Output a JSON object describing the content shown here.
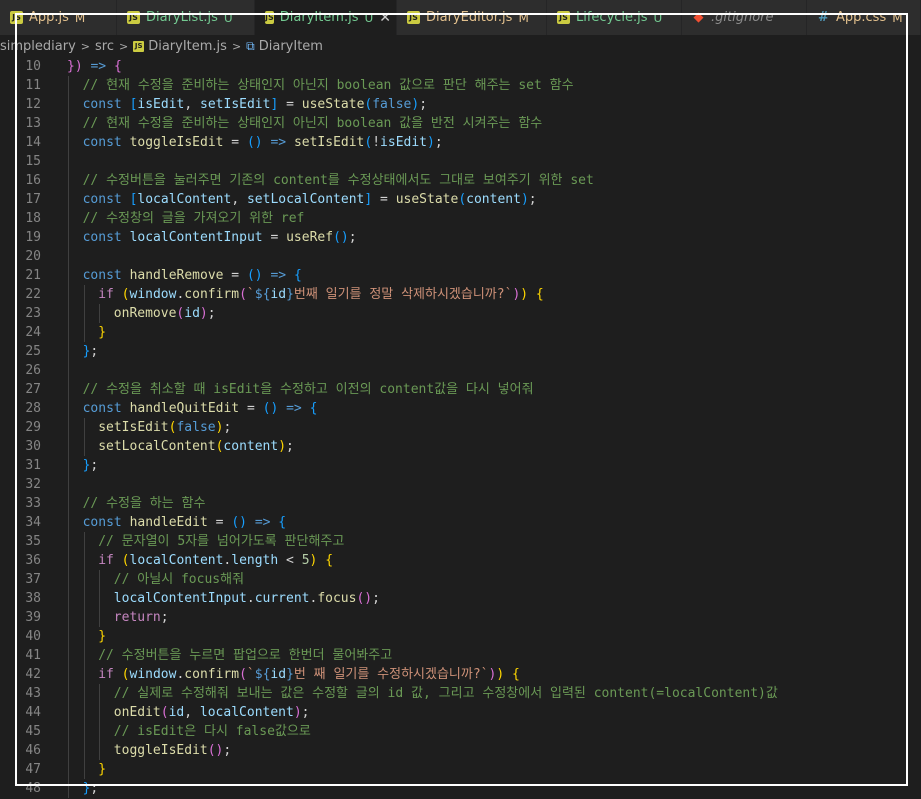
{
  "tabs": [
    {
      "name": "App.js",
      "status": "M",
      "icon": "js-file-icon",
      "active": false,
      "color": "#e2c08d"
    },
    {
      "name": "DiaryList.js",
      "status": "U",
      "icon": "js-file-icon",
      "active": false,
      "color": "#73c991"
    },
    {
      "name": "DiaryItem.js",
      "status": "U",
      "icon": "js-file-icon",
      "active": true,
      "color": "#73c991"
    },
    {
      "name": "DiaryEditor.js",
      "status": "M",
      "icon": "js-file-icon",
      "active": false,
      "color": "#e2c08d"
    },
    {
      "name": "Lifecycle.js",
      "status": "U",
      "icon": "js-file-icon",
      "active": false,
      "color": "#73c991"
    },
    {
      "name": ".gitignore",
      "status": "",
      "icon": "git-file-icon",
      "active": false,
      "color": "#8c8c8c"
    },
    {
      "name": "App.css",
      "status": "M",
      "icon": "css-file-icon",
      "active": false,
      "color": "#e2c08d"
    }
  ],
  "breadcrumb": {
    "project": "simplediary",
    "folder": "src",
    "file": "DiaryItem.js",
    "symbol": "DiaryItem"
  },
  "code_lines": [
    {
      "n": "10",
      "indent": 0,
      "tokens": [
        [
          "b2",
          "})"
        ],
        [
          "pl",
          " "
        ],
        [
          "kw",
          "=>"
        ],
        [
          "pl",
          " "
        ],
        [
          "b2",
          "{"
        ]
      ]
    },
    {
      "n": "11",
      "indent": 1,
      "tokens": [
        [
          "cm",
          "// 현재 수정을 준비하는 상태인지 아닌지 boolean 값으로 판단 해주는 set 함수"
        ]
      ]
    },
    {
      "n": "12",
      "indent": 1,
      "tokens": [
        [
          "kw",
          "const"
        ],
        [
          "pl",
          " "
        ],
        [
          "b3",
          "["
        ],
        [
          "var",
          "isEdit"
        ],
        [
          "pl",
          ", "
        ],
        [
          "var",
          "setIsEdit"
        ],
        [
          "b3",
          "]"
        ],
        [
          "pl",
          " = "
        ],
        [
          "fn",
          "useState"
        ],
        [
          "b3",
          "("
        ],
        [
          "kw",
          "false"
        ],
        [
          "b3",
          ")"
        ],
        [
          "pl",
          ";"
        ]
      ]
    },
    {
      "n": "13",
      "indent": 1,
      "tokens": [
        [
          "cm",
          "// 현재 수정을 준비하는 상태인지 아닌지 boolean 값을 반전 시켜주는 함수"
        ]
      ]
    },
    {
      "n": "14",
      "indent": 1,
      "tokens": [
        [
          "kw",
          "const"
        ],
        [
          "pl",
          " "
        ],
        [
          "fn",
          "toggleIsEdit"
        ],
        [
          "pl",
          " = "
        ],
        [
          "b3",
          "()"
        ],
        [
          "pl",
          " "
        ],
        [
          "kw",
          "=>"
        ],
        [
          "pl",
          " "
        ],
        [
          "fn",
          "setIsEdit"
        ],
        [
          "b3",
          "("
        ],
        [
          "pl",
          "!"
        ],
        [
          "var",
          "isEdit"
        ],
        [
          "b3",
          ")"
        ],
        [
          "pl",
          ";"
        ]
      ]
    },
    {
      "n": "15",
      "indent": 1,
      "tokens": []
    },
    {
      "n": "16",
      "indent": 1,
      "tokens": [
        [
          "cm",
          "// 수정버튼을 눌러주면 기존의 content를 수정상태에서도 그대로 보여주기 위한 set"
        ]
      ]
    },
    {
      "n": "17",
      "indent": 1,
      "tokens": [
        [
          "kw",
          "const"
        ],
        [
          "pl",
          " "
        ],
        [
          "b3",
          "["
        ],
        [
          "var",
          "localContent"
        ],
        [
          "pl",
          ", "
        ],
        [
          "var",
          "setLocalContent"
        ],
        [
          "b3",
          "]"
        ],
        [
          "pl",
          " = "
        ],
        [
          "fn",
          "useState"
        ],
        [
          "b3",
          "("
        ],
        [
          "var",
          "content"
        ],
        [
          "b3",
          ")"
        ],
        [
          "pl",
          ";"
        ]
      ]
    },
    {
      "n": "18",
      "indent": 1,
      "tokens": [
        [
          "cm",
          "// 수정창의 글을 가져오기 위한 ref"
        ]
      ]
    },
    {
      "n": "19",
      "indent": 1,
      "tokens": [
        [
          "kw",
          "const"
        ],
        [
          "pl",
          " "
        ],
        [
          "var",
          "localContentInput"
        ],
        [
          "pl",
          " = "
        ],
        [
          "fn",
          "useRef"
        ],
        [
          "b3",
          "()"
        ],
        [
          "pl",
          ";"
        ]
      ]
    },
    {
      "n": "20",
      "indent": 1,
      "tokens": []
    },
    {
      "n": "21",
      "indent": 1,
      "tokens": [
        [
          "kw",
          "const"
        ],
        [
          "pl",
          " "
        ],
        [
          "fn",
          "handleRemove"
        ],
        [
          "pl",
          " = "
        ],
        [
          "b3",
          "()"
        ],
        [
          "pl",
          " "
        ],
        [
          "kw",
          "=>"
        ],
        [
          "pl",
          " "
        ],
        [
          "b3",
          "{"
        ]
      ]
    },
    {
      "n": "22",
      "indent": 2,
      "tokens": [
        [
          "kw2",
          "if"
        ],
        [
          "pl",
          " "
        ],
        [
          "b1",
          "("
        ],
        [
          "var",
          "window"
        ],
        [
          "pl",
          "."
        ],
        [
          "fn",
          "confirm"
        ],
        [
          "b2",
          "("
        ],
        [
          "str",
          "`"
        ],
        [
          "kw",
          "${"
        ],
        [
          "var",
          "id"
        ],
        [
          "kw",
          "}"
        ],
        [
          "str",
          "번째 일기를 정말 삭제하시겠습니까?`"
        ],
        [
          "b2",
          ")"
        ],
        [
          "b1",
          ")"
        ],
        [
          "pl",
          " "
        ],
        [
          "b1",
          "{"
        ]
      ]
    },
    {
      "n": "23",
      "indent": 3,
      "tokens": [
        [
          "fn",
          "onRemove"
        ],
        [
          "b2",
          "("
        ],
        [
          "var",
          "id"
        ],
        [
          "b2",
          ")"
        ],
        [
          "pl",
          ";"
        ]
      ]
    },
    {
      "n": "24",
      "indent": 2,
      "tokens": [
        [
          "b1",
          "}"
        ]
      ]
    },
    {
      "n": "25",
      "indent": 1,
      "tokens": [
        [
          "b3",
          "}"
        ],
        [
          "pl",
          ";"
        ]
      ]
    },
    {
      "n": "26",
      "indent": 1,
      "tokens": []
    },
    {
      "n": "27",
      "indent": 1,
      "tokens": [
        [
          "cm",
          "// 수정을 취소할 때 isEdit을 수정하고 이전의 content값을 다시 넣어줘"
        ]
      ]
    },
    {
      "n": "28",
      "indent": 1,
      "tokens": [
        [
          "kw",
          "const"
        ],
        [
          "pl",
          " "
        ],
        [
          "fn",
          "handleQuitEdit"
        ],
        [
          "pl",
          " = "
        ],
        [
          "b3",
          "()"
        ],
        [
          "pl",
          " "
        ],
        [
          "kw",
          "=>"
        ],
        [
          "pl",
          " "
        ],
        [
          "b3",
          "{"
        ]
      ]
    },
    {
      "n": "29",
      "indent": 2,
      "tokens": [
        [
          "fn",
          "setIsEdit"
        ],
        [
          "b1",
          "("
        ],
        [
          "kw",
          "false"
        ],
        [
          "b1",
          ")"
        ],
        [
          "pl",
          ";"
        ]
      ]
    },
    {
      "n": "30",
      "indent": 2,
      "tokens": [
        [
          "fn",
          "setLocalContent"
        ],
        [
          "b1",
          "("
        ],
        [
          "var",
          "content"
        ],
        [
          "b1",
          ")"
        ],
        [
          "pl",
          ";"
        ]
      ]
    },
    {
      "n": "31",
      "indent": 1,
      "tokens": [
        [
          "b3",
          "}"
        ],
        [
          "pl",
          ";"
        ]
      ]
    },
    {
      "n": "32",
      "indent": 1,
      "tokens": []
    },
    {
      "n": "33",
      "indent": 1,
      "tokens": [
        [
          "cm",
          "// 수정을 하는 함수"
        ]
      ]
    },
    {
      "n": "34",
      "indent": 1,
      "tokens": [
        [
          "kw",
          "const"
        ],
        [
          "pl",
          " "
        ],
        [
          "fn",
          "handleEdit"
        ],
        [
          "pl",
          " = "
        ],
        [
          "b3",
          "()"
        ],
        [
          "pl",
          " "
        ],
        [
          "kw",
          "=>"
        ],
        [
          "pl",
          " "
        ],
        [
          "b3",
          "{"
        ]
      ]
    },
    {
      "n": "35",
      "indent": 2,
      "tokens": [
        [
          "cm",
          "// 문자열이 5자를 넘어가도록 판단해주고"
        ]
      ]
    },
    {
      "n": "36",
      "indent": 2,
      "tokens": [
        [
          "kw2",
          "if"
        ],
        [
          "pl",
          " "
        ],
        [
          "b1",
          "("
        ],
        [
          "var",
          "localContent"
        ],
        [
          "pl",
          "."
        ],
        [
          "var",
          "length"
        ],
        [
          "pl",
          " < "
        ],
        [
          "num",
          "5"
        ],
        [
          "b1",
          ")"
        ],
        [
          "pl",
          " "
        ],
        [
          "b1",
          "{"
        ]
      ]
    },
    {
      "n": "37",
      "indent": 3,
      "tokens": [
        [
          "cm",
          "// 아닐시 focus해줘"
        ]
      ]
    },
    {
      "n": "38",
      "indent": 3,
      "tokens": [
        [
          "var",
          "localContentInput"
        ],
        [
          "pl",
          "."
        ],
        [
          "var",
          "current"
        ],
        [
          "pl",
          "."
        ],
        [
          "fn",
          "focus"
        ],
        [
          "b2",
          "()"
        ],
        [
          "pl",
          ";"
        ]
      ]
    },
    {
      "n": "39",
      "indent": 3,
      "tokens": [
        [
          "kw2",
          "return"
        ],
        [
          "pl",
          ";"
        ]
      ]
    },
    {
      "n": "40",
      "indent": 2,
      "tokens": [
        [
          "b1",
          "}"
        ]
      ]
    },
    {
      "n": "41",
      "indent": 2,
      "tokens": [
        [
          "cm",
          "// 수정버튼을 누르면 팝업으로 한번더 물어봐주고"
        ]
      ]
    },
    {
      "n": "42",
      "indent": 2,
      "tokens": [
        [
          "kw2",
          "if"
        ],
        [
          "pl",
          " "
        ],
        [
          "b1",
          "("
        ],
        [
          "var",
          "window"
        ],
        [
          "pl",
          "."
        ],
        [
          "fn",
          "confirm"
        ],
        [
          "b2",
          "("
        ],
        [
          "str",
          "`"
        ],
        [
          "kw",
          "${"
        ],
        [
          "var",
          "id"
        ],
        [
          "kw",
          "}"
        ],
        [
          "str",
          "번 째 일기를 수정하시겠습니까?`"
        ],
        [
          "b2",
          ")"
        ],
        [
          "b1",
          ")"
        ],
        [
          "pl",
          " "
        ],
        [
          "b1",
          "{"
        ]
      ]
    },
    {
      "n": "43",
      "indent": 3,
      "tokens": [
        [
          "cm",
          "// 실제로 수정해줘 보내는 값은 수정할 글의 id 값, 그리고 수정창에서 입력된 content(=localContent)값"
        ]
      ]
    },
    {
      "n": "44",
      "indent": 3,
      "tokens": [
        [
          "fn",
          "onEdit"
        ],
        [
          "b2",
          "("
        ],
        [
          "var",
          "id"
        ],
        [
          "pl",
          ", "
        ],
        [
          "var",
          "localContent"
        ],
        [
          "b2",
          ")"
        ],
        [
          "pl",
          ";"
        ]
      ]
    },
    {
      "n": "45",
      "indent": 3,
      "tokens": [
        [
          "cm",
          "// isEdit은 다시 false값으로"
        ]
      ]
    },
    {
      "n": "46",
      "indent": 3,
      "tokens": [
        [
          "fn",
          "toggleIsEdit"
        ],
        [
          "b2",
          "()"
        ],
        [
          "pl",
          ";"
        ]
      ]
    },
    {
      "n": "47",
      "indent": 2,
      "tokens": [
        [
          "b1",
          "}"
        ]
      ]
    },
    {
      "n": "48",
      "indent": 1,
      "tokens": [
        [
          "b3",
          "}"
        ],
        [
          "pl",
          ";"
        ]
      ]
    }
  ],
  "colors": {
    "editor_bg": "#1e1e1e",
    "tab_bar_bg": "#252526",
    "line_number": "#858585",
    "modified": "#e2c08d",
    "untracked": "#73c991"
  }
}
